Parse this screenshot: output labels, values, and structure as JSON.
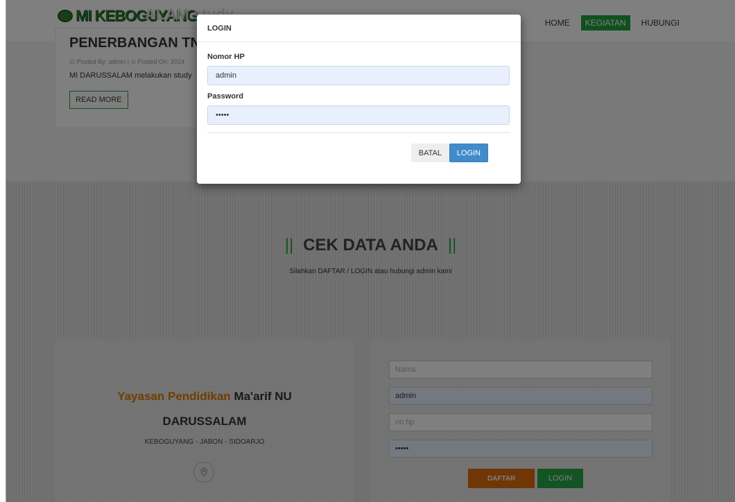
{
  "header": {
    "logo_text": "MI KEBOGUYANG",
    "ghost_title": "ALAM study",
    "nav": [
      {
        "label": "HOME"
      },
      {
        "label": "KEGIATAN"
      },
      {
        "label": "HUBUNGI"
      }
    ]
  },
  "post": {
    "title": "PENERBANGAN TNI A",
    "meta": "☑ Posted By: admin  |  ⊙ Posted On: 2024",
    "excerpt": "MI DARUSSALAM melakukan study",
    "read_more": "READ MORE"
  },
  "cek": {
    "bar_left": "||",
    "title": "CEK DATA ANDA",
    "bar_right": "||",
    "subtitle": "Silahkan DAFTAR / LOGIN atau hubungi admin kami"
  },
  "school": {
    "yayasan_orange": "Yayasan Pendidikan",
    "yayasan_dark": "Ma'arif NU",
    "name": "DARUSSALAM",
    "address": "KEBOGUYANG - JABON - SIDOARJO"
  },
  "register_form": {
    "nama_placeholder": "Nama",
    "field2_value": "admin",
    "nohp_placeholder": "no hp",
    "password_value": "•••••",
    "daftar_label": "DAFTAR",
    "login_label": "LOGIN"
  },
  "modal": {
    "title": "LOGIN",
    "phone_label": "Nomor HP",
    "phone_value": "admin",
    "password_label": "Password",
    "password_value": "•••••",
    "cancel_label": "BATAL",
    "login_label": "LOGIN"
  },
  "colors": {
    "accent_green": "#1ea33a",
    "login_blue": "#428bca",
    "daftar_orange": "#e36c0a"
  }
}
